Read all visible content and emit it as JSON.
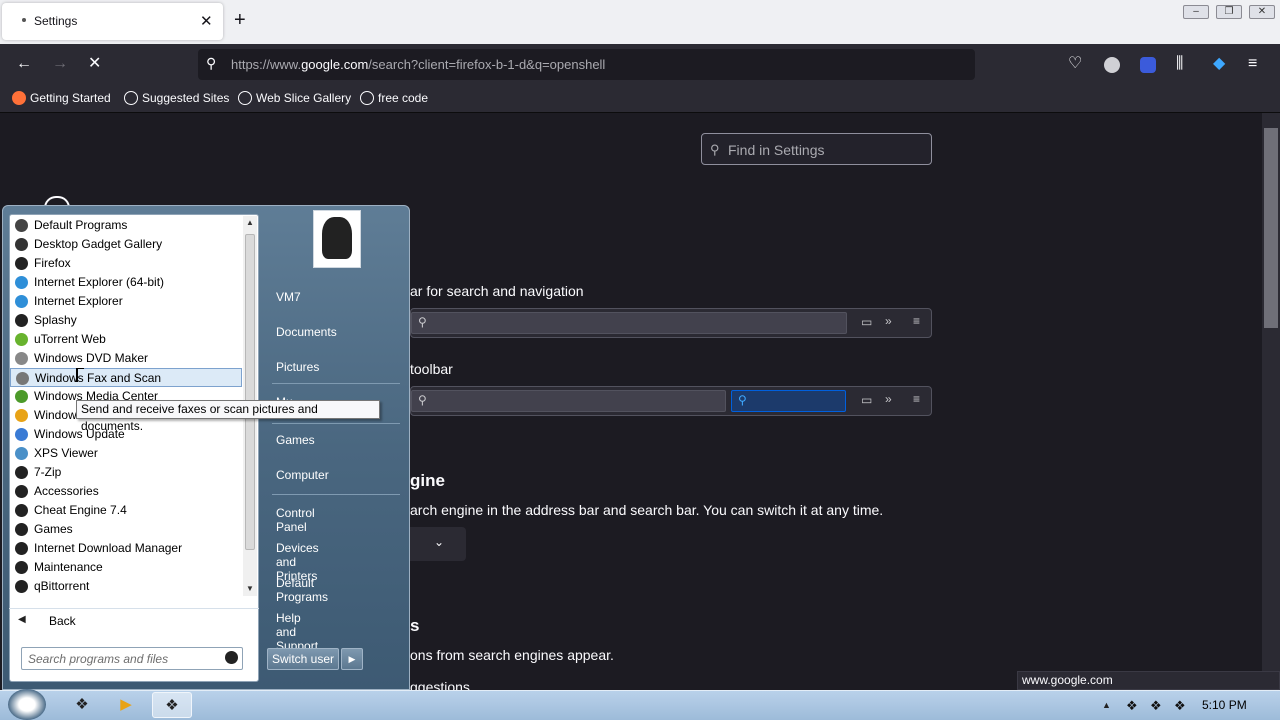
{
  "browser": {
    "tab_title": "Settings",
    "new_tab": "+",
    "url_prefix": "https://www.",
    "url_domain": "google.com",
    "url_rest": "/search?client=firefox-b-1-d&q=openshell",
    "bookmarks": [
      "Getting Started",
      "Suggested Sites",
      "Web Slice Gallery",
      "free code"
    ],
    "status_url": "www.google.com"
  },
  "settings": {
    "find_placeholder": "Find in Settings",
    "partial_icon_text": "G",
    "search_bar_heading": "ar for search and navigation",
    "toolbar_heading": "toolbar",
    "engine_heading": "gine",
    "engine_desc": "arch engine in the address bar and search bar. You can switch it at any time.",
    "suggestions_heading": "s",
    "suggestions_desc": "ons from search engines appear.",
    "suggestions_partial": "ggestions"
  },
  "start_menu": {
    "programs": [
      {
        "label": "Default Programs",
        "icon": "gear-icon"
      },
      {
        "label": "Desktop Gadget Gallery",
        "icon": "gadget-icon"
      },
      {
        "label": "Firefox",
        "icon": "app-icon"
      },
      {
        "label": "Internet Explorer (64-bit)",
        "icon": "ie-icon"
      },
      {
        "label": "Internet Explorer",
        "icon": "ie-icon"
      },
      {
        "label": "Splashy",
        "icon": "app-icon"
      },
      {
        "label": "uTorrent Web",
        "icon": "utorrent-icon"
      },
      {
        "label": "Windows DVD Maker",
        "icon": "dvd-icon"
      },
      {
        "label": "Windows Fax and Scan",
        "icon": "fax-icon"
      },
      {
        "label": "Windows Media Center",
        "icon": "media-center-icon"
      },
      {
        "label": "Windows",
        "icon": "media-player-icon"
      },
      {
        "label": "Windows Update",
        "icon": "update-icon"
      },
      {
        "label": "XPS Viewer",
        "icon": "xps-icon"
      },
      {
        "label": "7-Zip",
        "icon": "folder-icon"
      },
      {
        "label": "Accessories",
        "icon": "folder-icon"
      },
      {
        "label": "Cheat Engine 7.4",
        "icon": "folder-icon"
      },
      {
        "label": "Games",
        "icon": "folder-icon"
      },
      {
        "label": "Internet Download Manager",
        "icon": "folder-icon"
      },
      {
        "label": "Maintenance",
        "icon": "folder-icon"
      },
      {
        "label": "qBittorrent",
        "icon": "folder-icon"
      }
    ],
    "back_label": "Back",
    "search_placeholder": "Search programs and files",
    "right_items": [
      "VM7",
      "Documents",
      "Pictures",
      "Mu",
      "Games",
      "Computer",
      "Control Panel",
      "Devices and Printers",
      "Default Programs",
      "Help and Support"
    ],
    "switch_user": "Switch user",
    "tooltip": "Send and receive faxes or scan pictures and documents."
  },
  "taskbar": {
    "clock": "5:10 PM"
  }
}
